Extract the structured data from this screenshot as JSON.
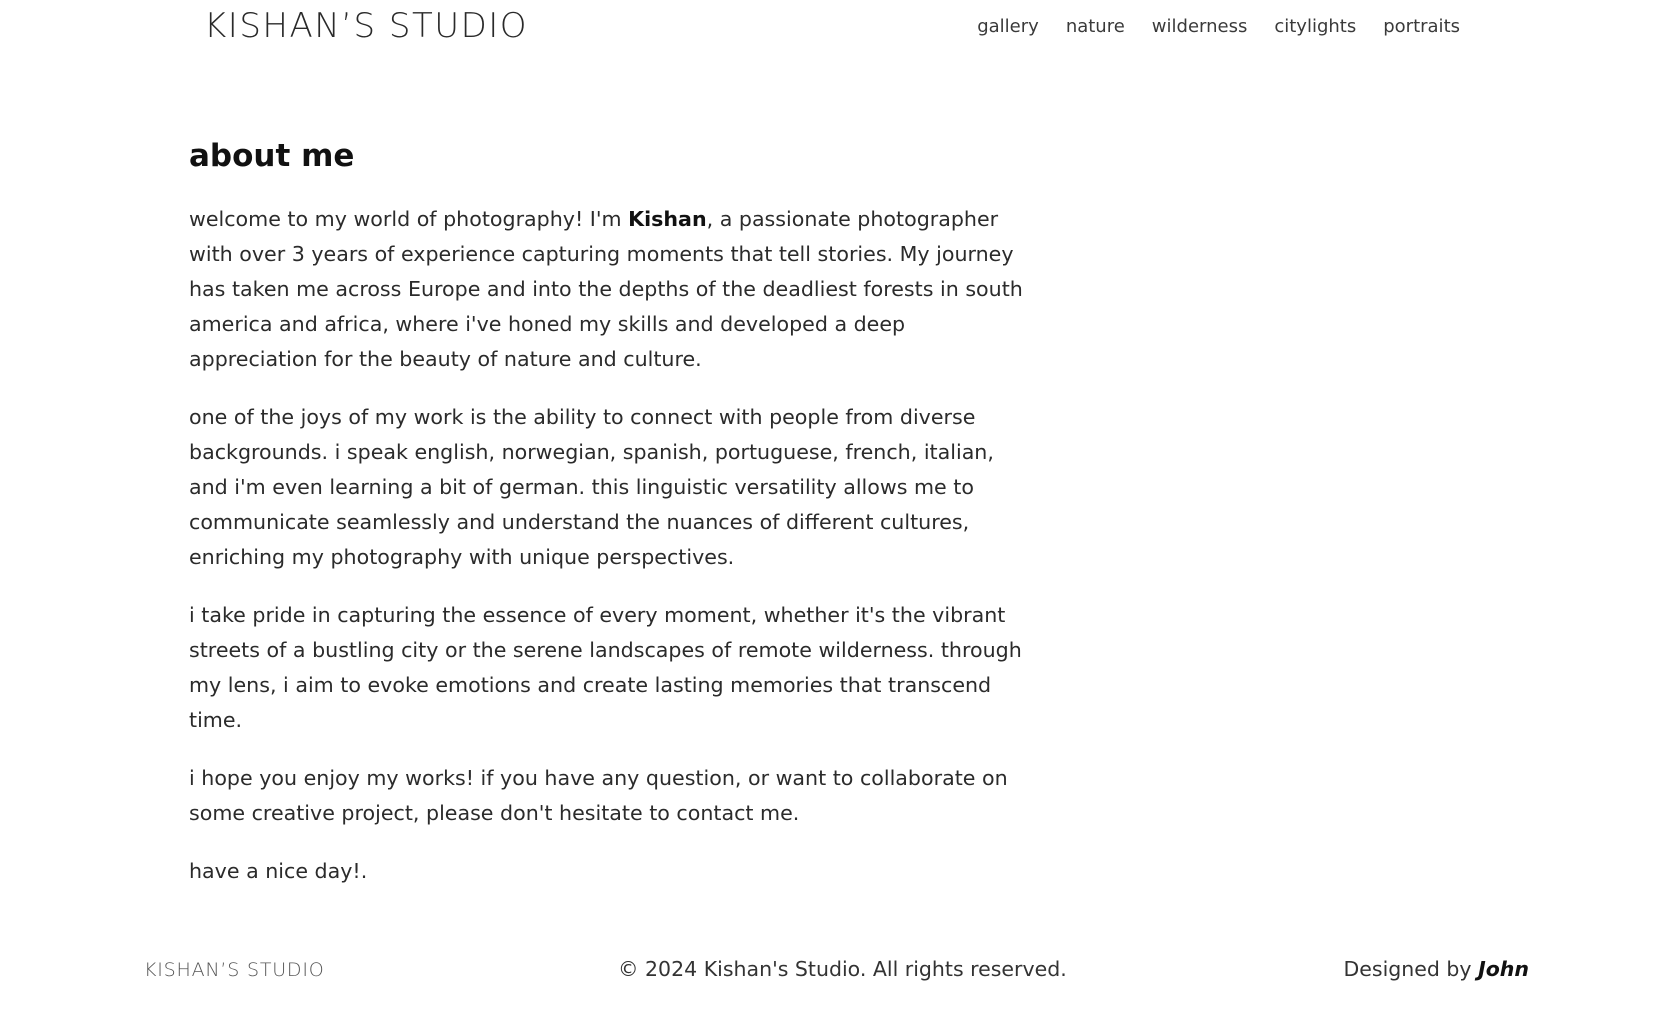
{
  "header": {
    "logo": "KISHAN’S STUDIO",
    "nav": [
      {
        "label": "gallery"
      },
      {
        "label": "nature"
      },
      {
        "label": "wilderness"
      },
      {
        "label": "citylights"
      },
      {
        "label": "portraits"
      }
    ]
  },
  "main": {
    "title": "about me",
    "intro_before": "welcome to my world of photography! I'm ",
    "intro_name": "Kishan",
    "intro_after": ", a passionate photographer with over 3 years of experience capturing moments that tell stories. My journey has taken me across Europe and into the depths of the deadliest forests in south america and africa, where i've honed my skills and developed a deep appreciation for the beauty of nature and culture.",
    "paragraphs": [
      "one of the joys of my work is the ability to connect with people from diverse backgrounds. i speak english, norwegian, spanish, portuguese, french, italian, and i'm even learning a bit of german. this linguistic versatility allows me to communicate seamlessly and understand the nuances of different cultures, enriching my photography with unique perspectives.",
      "i take pride in capturing the essence of every moment, whether it's the vibrant streets of a bustling city or the serene landscapes of remote wilderness. through my lens, i aim to evoke emotions and create lasting memories that transcend time.",
      "i hope you enjoy my works! if you have any question, or want to collaborate on some creative project, please don't hesitate to contact me.",
      "have a nice day!."
    ]
  },
  "footer": {
    "logo": "KISHAN’S STUDIO",
    "copyright": "© 2024 Kishan's Studio. All rights reserved.",
    "designed_prefix": "Designed by ",
    "designer": "John"
  }
}
